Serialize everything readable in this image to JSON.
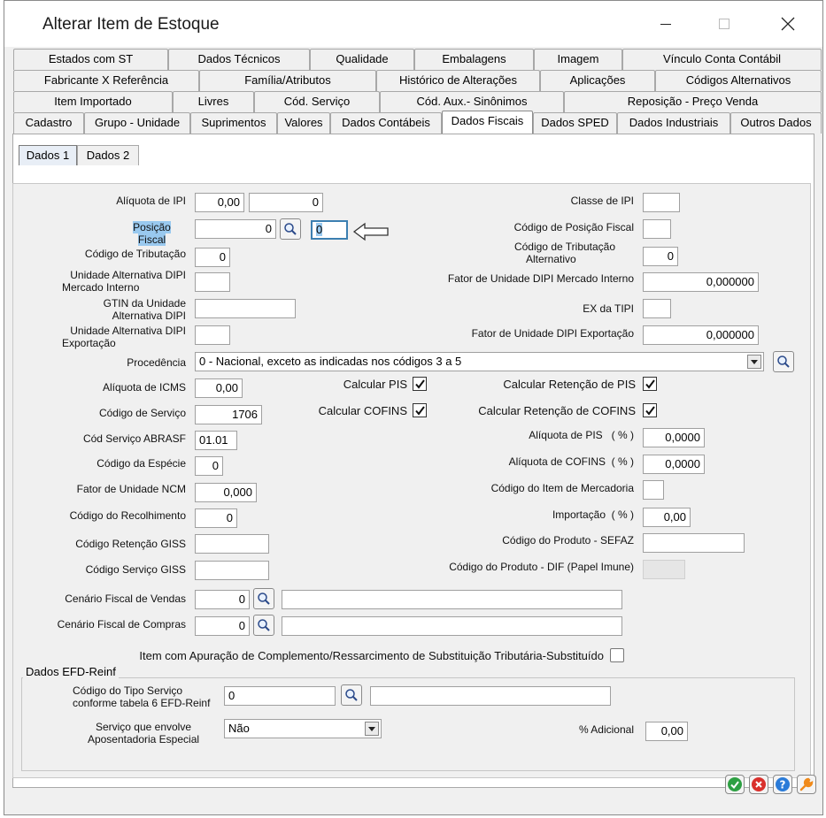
{
  "window": {
    "title": "Alterar Item de Estoque"
  },
  "tabs": {
    "row1": [
      "Estados com ST",
      "Dados Técnicos",
      "Qualidade",
      "Embalagens",
      "Imagem",
      "Vínculo Conta Contábil"
    ],
    "row2": [
      "Fabricante X Referência",
      "Família/Atributos",
      "Histórico de Alterações",
      "Aplicações",
      "Códigos Alternativos"
    ],
    "row3": [
      "Item Importado",
      "Livres",
      "Cód. Serviço",
      "Cód. Aux.- Sinônimos",
      "Reposição - Preço Venda"
    ],
    "row4": [
      "Cadastro",
      "Grupo - Unidade",
      "Suprimentos",
      "Valores",
      "Dados Contábeis",
      "Dados Fiscais",
      "Dados SPED",
      "Dados Industriais",
      "Outros Dados"
    ],
    "active": "Dados Fiscais"
  },
  "subtabs": [
    "Dados 1",
    "Dados 2"
  ],
  "form": {
    "aliquota_ipi": {
      "label": "Alíquota de IPI",
      "value1": "0,00",
      "value2": "0"
    },
    "posicao_fiscal": {
      "label": "Posição Fiscal",
      "value": "0",
      "extra": "0"
    },
    "codigo_tributacao": {
      "label": "Código de Tributação",
      "value": "0"
    },
    "unidade_alt_dipi_mi": {
      "label1": "Unidade Alternativa DIPI",
      "label2": "Mercado Interno",
      "value": ""
    },
    "gtin": {
      "label1": "GTIN da Unidade",
      "label2": "Alternativa DIPI",
      "value": ""
    },
    "unidade_alt_dipi_exp": {
      "label1": "Unidade Alternativa DIPI",
      "label2": "Exportação",
      "value": ""
    },
    "classe_ipi": {
      "label": "Classe de IPI",
      "value": ""
    },
    "codigo_posicao_fiscal": {
      "label": "Código de Posição Fiscal",
      "value": ""
    },
    "codigo_trib_alt": {
      "label1": "Código de Tributação",
      "label2": "Alternativo",
      "value": "0"
    },
    "fator_dipi_mi": {
      "label": "Fator de Unidade DIPI Mercado Interno",
      "value": "0,000000"
    },
    "ex_tipi": {
      "label": "EX da TIPI",
      "value": ""
    },
    "fator_dipi_exp": {
      "label": "Fator de Unidade DIPI Exportação",
      "value": "0,000000"
    },
    "procedencia": {
      "label": "Procedência",
      "value": "0 - Nacional, exceto as indicadas nos códigos 3 a 5"
    },
    "aliquota_icms": {
      "label": "Alíquota de ICMS",
      "value": "0,00"
    },
    "codigo_servico": {
      "label": "Código de Serviço",
      "value": "1706"
    },
    "cod_servico_abrasf": {
      "label": "Cód Serviço ABRASF",
      "value": "01.01"
    },
    "codigo_especie": {
      "label": "Código da Espécie",
      "value": "0"
    },
    "fator_ncm": {
      "label": "Fator de Unidade NCM",
      "value": "0,000"
    },
    "codigo_recolhimento": {
      "label": "Código do Recolhimento",
      "value": "0"
    },
    "codigo_retencao_giss": {
      "label": "Código Retenção GISS",
      "value": ""
    },
    "codigo_servico_giss": {
      "label": "Código Serviço GISS",
      "value": ""
    },
    "calcular_pis": {
      "label": "Calcular PIS",
      "checked": true
    },
    "calcular_cofins": {
      "label": "Calcular COFINS",
      "checked": true
    },
    "calc_ret_pis": {
      "label": "Calcular Retenção de PIS",
      "checked": true
    },
    "calc_ret_cofins": {
      "label": "Calcular Retenção de COFINS",
      "checked": true
    },
    "aliquota_pis": {
      "label": "Alíquota de PIS   ( % )",
      "value": "0,0000"
    },
    "aliquota_cofins": {
      "label": "Alíquota de COFINS  ( % )",
      "value": "0,0000"
    },
    "codigo_item_mercadoria": {
      "label": "Código do Item de Mercadoria",
      "value": ""
    },
    "importacao": {
      "label": "Importação  ( % )",
      "value": "0,00"
    },
    "codigo_produto_sefaz": {
      "label": "Código do Produto - SEFAZ",
      "value": ""
    },
    "codigo_produto_dif": {
      "label": "Código do Produto - DIF (Papel Imune)",
      "value": ""
    },
    "cenario_vendas": {
      "label": "Cenário Fiscal de Vendas",
      "value": "0",
      "desc": ""
    },
    "cenario_compras": {
      "label": "Cenário Fiscal de Compras",
      "value": "0",
      "desc": ""
    },
    "item_apuracao": {
      "label": "Item com Apuração de Complemento/Ressarcimento de Substituição Tributária-Substituído",
      "checked": false
    }
  },
  "efd_reinf": {
    "title": "Dados EFD-Reinf",
    "tipo_servico": {
      "label1": "Código do Tipo Serviço",
      "label2": "conforme tabela 6 EFD-Reinf",
      "value": "0",
      "desc": ""
    },
    "aposentadoria": {
      "label1": "Serviço que envolve",
      "label2": "Aposentadoria Especial",
      "value": "Não"
    },
    "adicional": {
      "label": "% Adicional",
      "value": "0,00"
    }
  },
  "colors": {
    "ok": "#2ea043",
    "cancel": "#d9302c",
    "help": "#2a7bd8",
    "tools": "#f08a1a",
    "highlight": "#99c9ef"
  }
}
